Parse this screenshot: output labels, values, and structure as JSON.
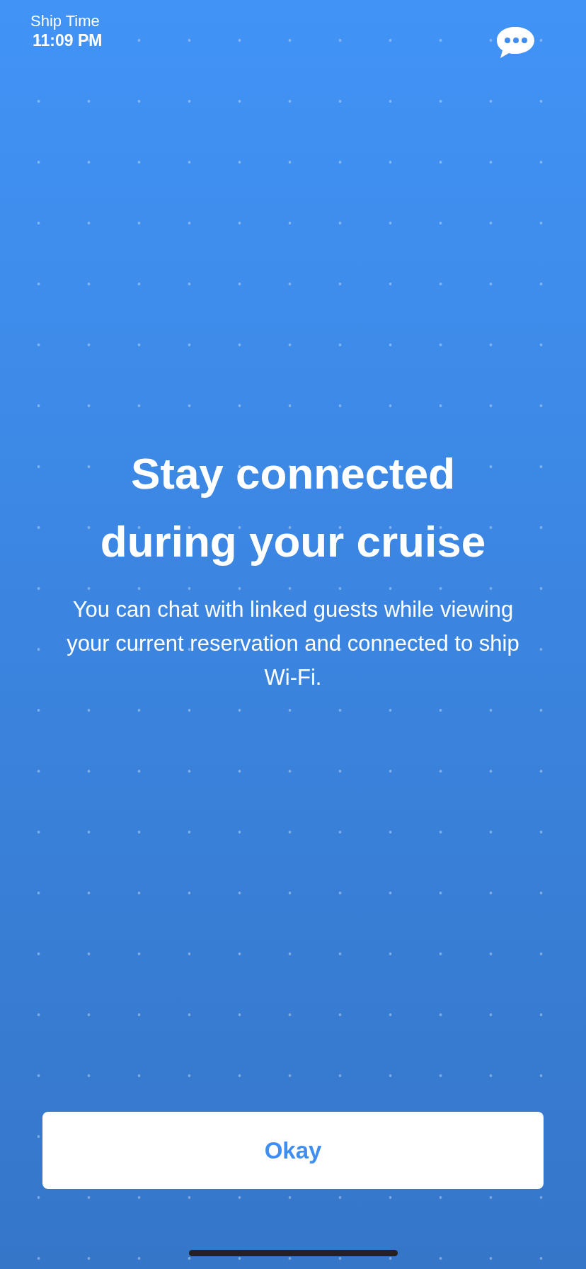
{
  "header": {
    "label": "Ship Time",
    "time": "11:09 PM"
  },
  "title": "Stay connected during your cruise",
  "message": "You can chat with linked guests while viewing your current reservation and connected to ship Wi-Fi.",
  "button": {
    "label": "Okay"
  }
}
